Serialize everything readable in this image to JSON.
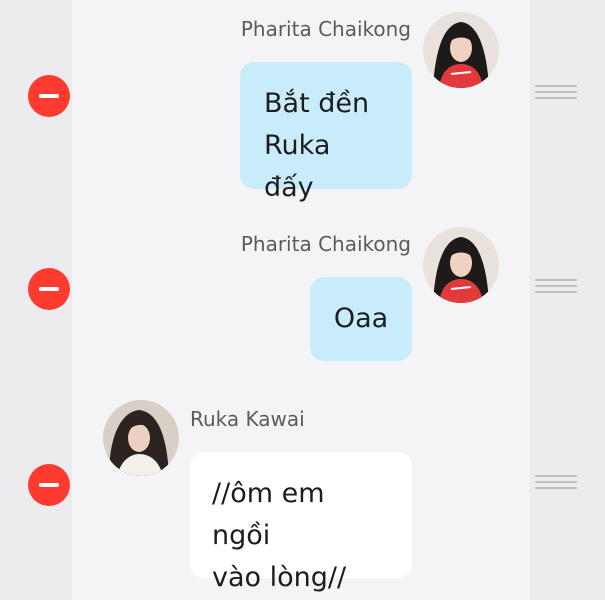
{
  "messages": [
    {
      "sender": "Pharita Chaikong",
      "lines": [
        "Bắt đền",
        "Ruka đấy"
      ],
      "side": "right",
      "avatar_icon": "person-red-shirt-icon"
    },
    {
      "sender": "Pharita Chaikong",
      "lines": [
        "Oaa"
      ],
      "side": "right",
      "avatar_icon": "person-red-shirt-icon"
    },
    {
      "sender": "Ruka Kawai",
      "lines": [
        "//ôm em ngồi",
        "vào lòng//"
      ],
      "side": "left",
      "avatar_icon": "person-long-hair-icon"
    }
  ],
  "colors": {
    "delete": "#ff3b30",
    "own_bubble": "#c9ecfb",
    "other_bubble": "#ffffff"
  }
}
